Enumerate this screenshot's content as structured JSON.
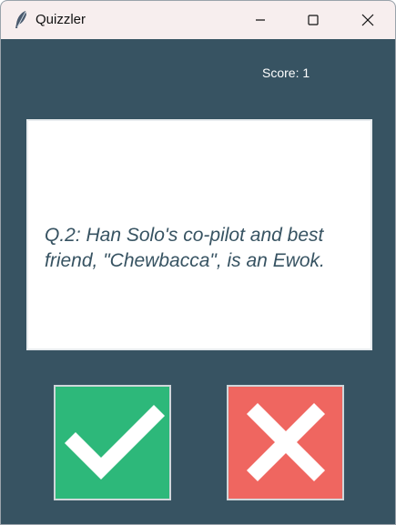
{
  "window": {
    "title": "Quizzler"
  },
  "titlebar": {
    "app_icon": "feather-icon",
    "controls": {
      "minimize_icon": "minimize-icon",
      "maximize_icon": "maximize-icon",
      "close_icon": "close-icon"
    }
  },
  "score": {
    "label": "Score: 1"
  },
  "question": {
    "text": "Q.2: Han Solo's co-pilot and best friend, \"Chewbacca\", is an Ewok."
  },
  "buttons": {
    "true_icon": "checkmark-icon",
    "false_icon": "cross-icon",
    "true_color": "#2db87a",
    "false_color": "#ef6660"
  },
  "colors": {
    "background": "#375362",
    "card": "#ffffff",
    "question_text": "#375362",
    "titlebar": "#f7eeee"
  }
}
